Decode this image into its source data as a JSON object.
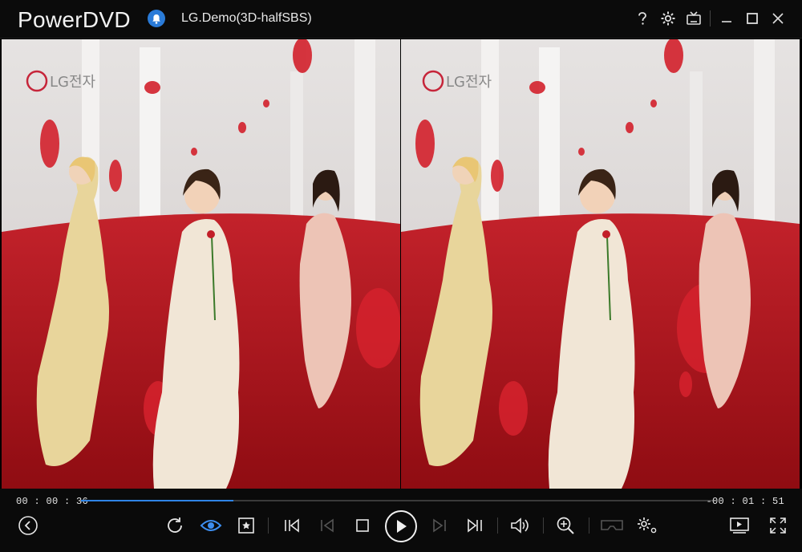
{
  "app": {
    "name": "PowerDVD",
    "document_title": "LG.Demo(3D-halfSBS)"
  },
  "window_controls": [
    "help-icon",
    "settings-icon",
    "tv-mode-icon",
    "minimize-icon",
    "maximize-icon",
    "close-icon"
  ],
  "video": {
    "watermark": "LG전자",
    "format": "3D half side-by-side"
  },
  "player": {
    "elapsed": "00 : 00 : 36",
    "remaining": "-00 : 01 : 51",
    "progress_fraction": 0.24
  },
  "toolbar": [
    "back-icon",
    "repeat-icon",
    "eye-icon",
    "bookmark-icon",
    "previous-chapter-icon",
    "step-back-icon",
    "stop-icon",
    "play-icon",
    "step-forward-icon",
    "next-chapter-icon",
    "volume-icon",
    "zoom-icon",
    "vr-icon",
    "settings-icon",
    "mini-player-icon",
    "fullscreen-icon"
  ],
  "colors": {
    "accent": "#2f84e6",
    "notification": "#2a7bd8",
    "background": "#0a0a0a"
  }
}
